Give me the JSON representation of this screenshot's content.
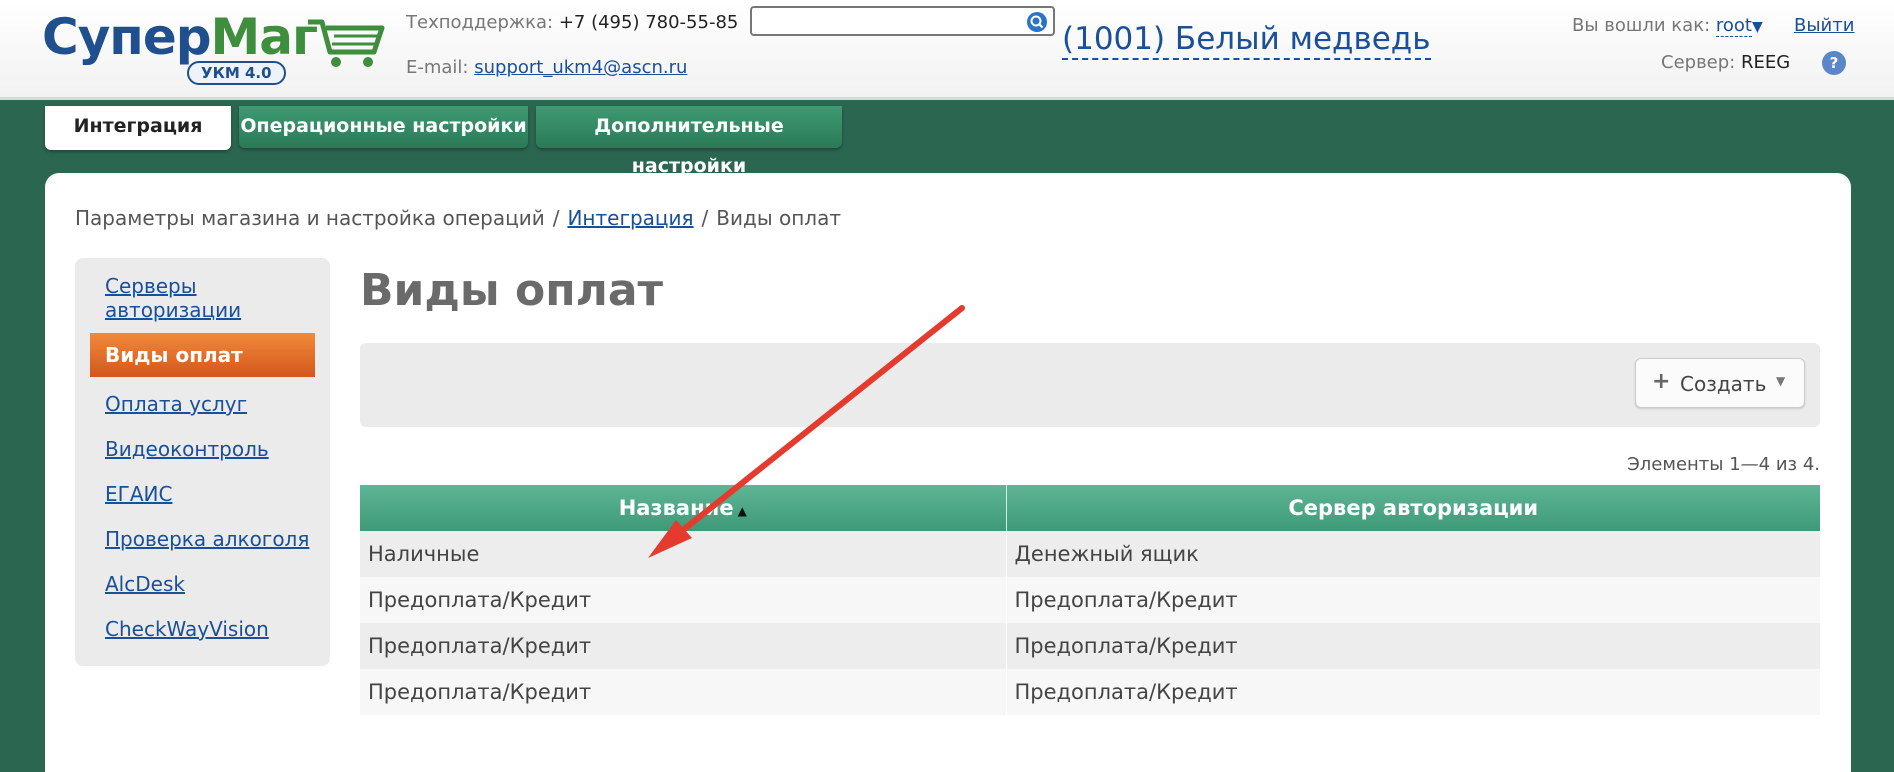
{
  "header": {
    "logo_main": "Супер",
    "logo_accent": "Маг",
    "logo_badge": "УКМ 4.0",
    "support_label": "Техподдержка:",
    "support_phone": "+7 (495) 780-55-85",
    "email_label": "E-mail:",
    "email_value": "support_ukm4@ascn.ru",
    "search_value": "",
    "store": "(1001) Белый медведь",
    "logged_label": "Вы вошли как:",
    "user": "root",
    "logout": "Выйти",
    "server_label": "Сервер:",
    "server_value": "REEG",
    "help": "?"
  },
  "tabs": [
    {
      "label": "Интеграция",
      "active": true
    },
    {
      "label": "Операционные настройки",
      "active": false
    },
    {
      "label": "Дополнительные настройки",
      "active": false
    }
  ],
  "breadcrumb": {
    "root": "Параметры магазина и настройка операций",
    "link": "Интеграция",
    "current": "Виды оплат",
    "separator": "/"
  },
  "sidebar": {
    "items": [
      {
        "label_line1": "Серверы",
        "label_line2": "авторизации"
      },
      {
        "label": "Виды оплат",
        "active": true
      },
      {
        "label": "Оплата услуг"
      },
      {
        "label": "Видеоконтроль"
      },
      {
        "label": "ЕГАИС"
      },
      {
        "label": "Проверка алкоголя"
      },
      {
        "label": "AlcDesk"
      },
      {
        "label": "CheckWayVision"
      }
    ]
  },
  "main": {
    "title": "Виды оплат",
    "create_label": "Создать",
    "count_text": "Элементы 1—4 из 4.",
    "columns": [
      "Название",
      "Сервер авторизации"
    ],
    "rows": [
      [
        "Наличные",
        "Денежный ящик"
      ],
      [
        "Предоплата/Кредит",
        "Предоплата/Кредит"
      ],
      [
        "Предоплата/Кредит",
        "Предоплата/Кредит"
      ],
      [
        "Предоплата/Кредит",
        "Предоплата/Кредит"
      ]
    ]
  },
  "icons": {
    "cart": "shopping-cart-icon",
    "search": "search-icon",
    "help": "help-icon",
    "plus": "plus-icon",
    "dropdown": "chevron-down-icon",
    "sort": "sort-asc-icon"
  },
  "colors": {
    "background": "#2b6650",
    "tab_green": "#3e9a72",
    "active_orange": "#e06a28",
    "link": "#1a4f99",
    "table_header": "#4ea885",
    "annotation_arrow": "#e53a2e"
  }
}
